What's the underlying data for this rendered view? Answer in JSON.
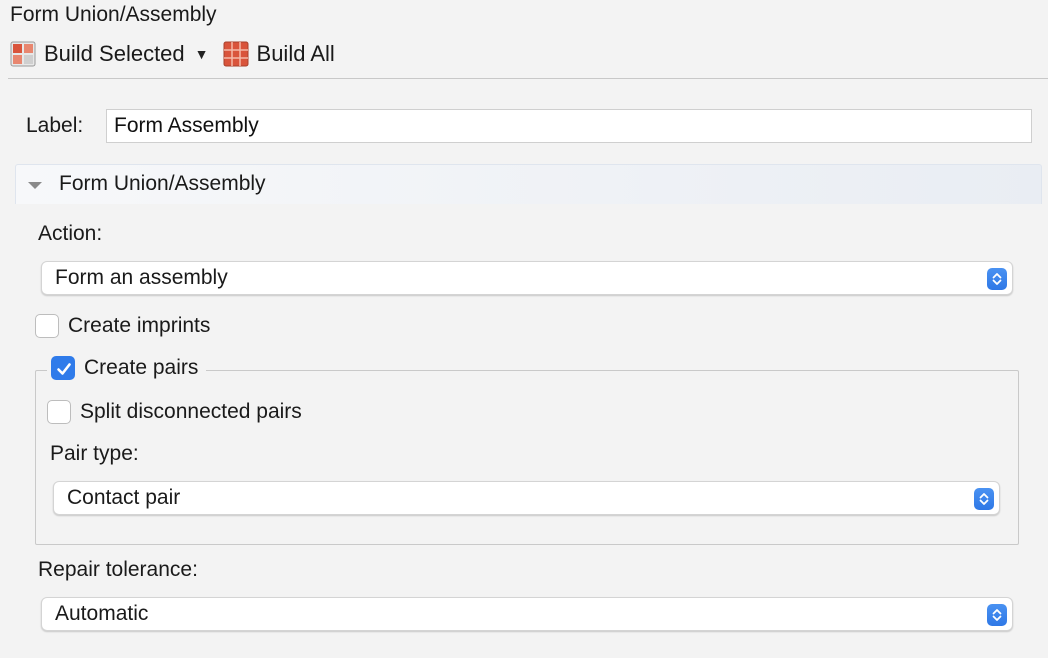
{
  "window": {
    "title": "Form Union/Assembly"
  },
  "toolbar": {
    "build_selected_label": "Build Selected",
    "build_selected_icon": "build-selected-icon",
    "dropdown_icon": "caret-down-icon",
    "build_all_label": "Build All",
    "build_all_icon": "build-all-icon",
    "icon_color": "#d9543b"
  },
  "label_field": {
    "label": "Label:",
    "value": "Form Assembly"
  },
  "section": {
    "title": "Form Union/Assembly",
    "expanded": true
  },
  "action": {
    "label": "Action:",
    "selected": "Form an assembly"
  },
  "create_imprints": {
    "label": "Create imprints",
    "checked": false
  },
  "create_pairs": {
    "label": "Create pairs",
    "checked": true,
    "split_disconnected": {
      "label": "Split disconnected pairs",
      "checked": false
    },
    "pair_type": {
      "label": "Pair type:",
      "selected": "Contact pair"
    }
  },
  "repair_tolerance": {
    "label": "Repair tolerance:",
    "selected": "Automatic"
  },
  "colors": {
    "accent": "#2f7bea",
    "background": "#f3f3f3"
  }
}
